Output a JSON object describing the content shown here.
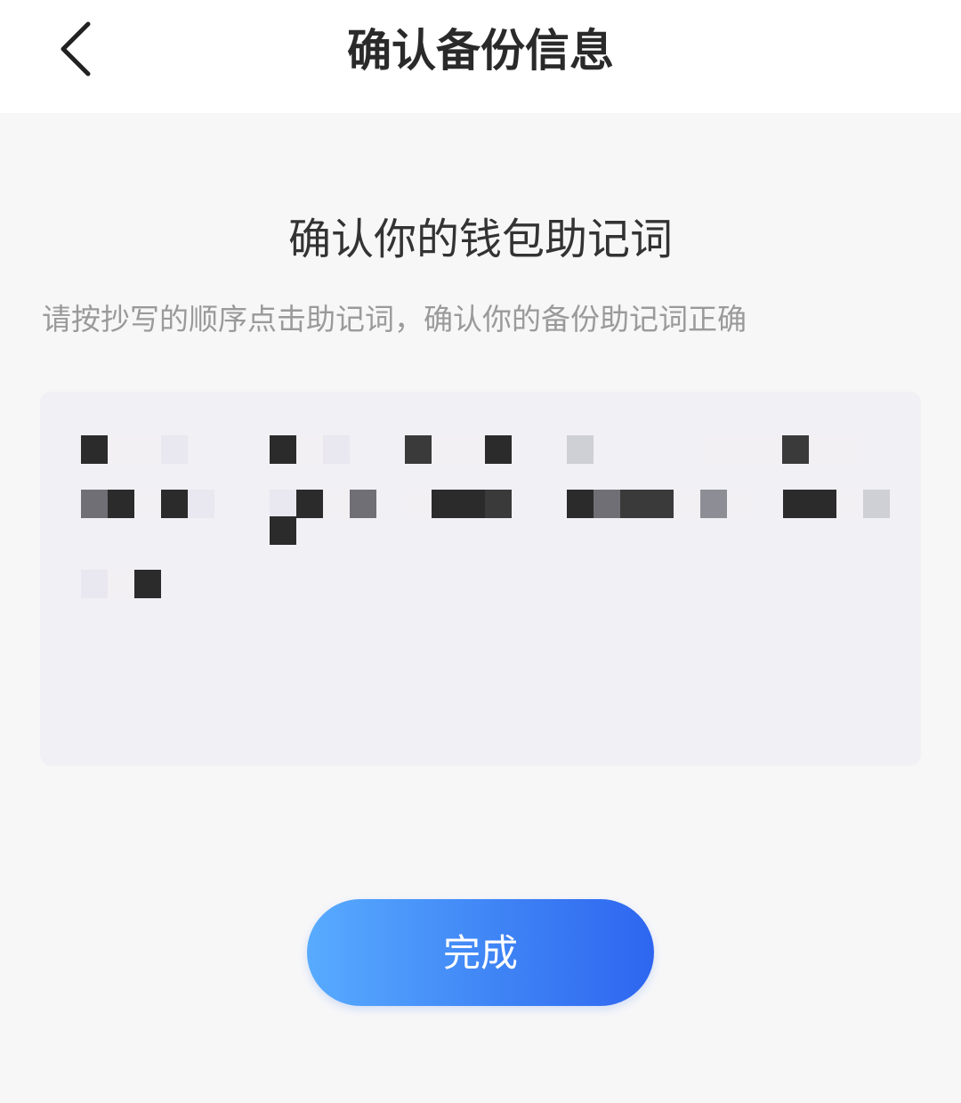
{
  "header": {
    "title": "确认备份信息",
    "back_icon": "chevron-left-icon"
  },
  "content": {
    "section_title": "确认你的钱包助记词",
    "instruction": "请按抄写的顺序点击助记词，确认你的备份助记词正确"
  },
  "mnemonic_area": {
    "words_hidden": true,
    "word_count": 12
  },
  "actions": {
    "done_label": "完成"
  },
  "colors": {
    "primary_gradient_start": "#58abff",
    "primary_gradient_end": "#2e66f0",
    "background": "#f7f7f8",
    "box_background": "#f0f0f5"
  }
}
